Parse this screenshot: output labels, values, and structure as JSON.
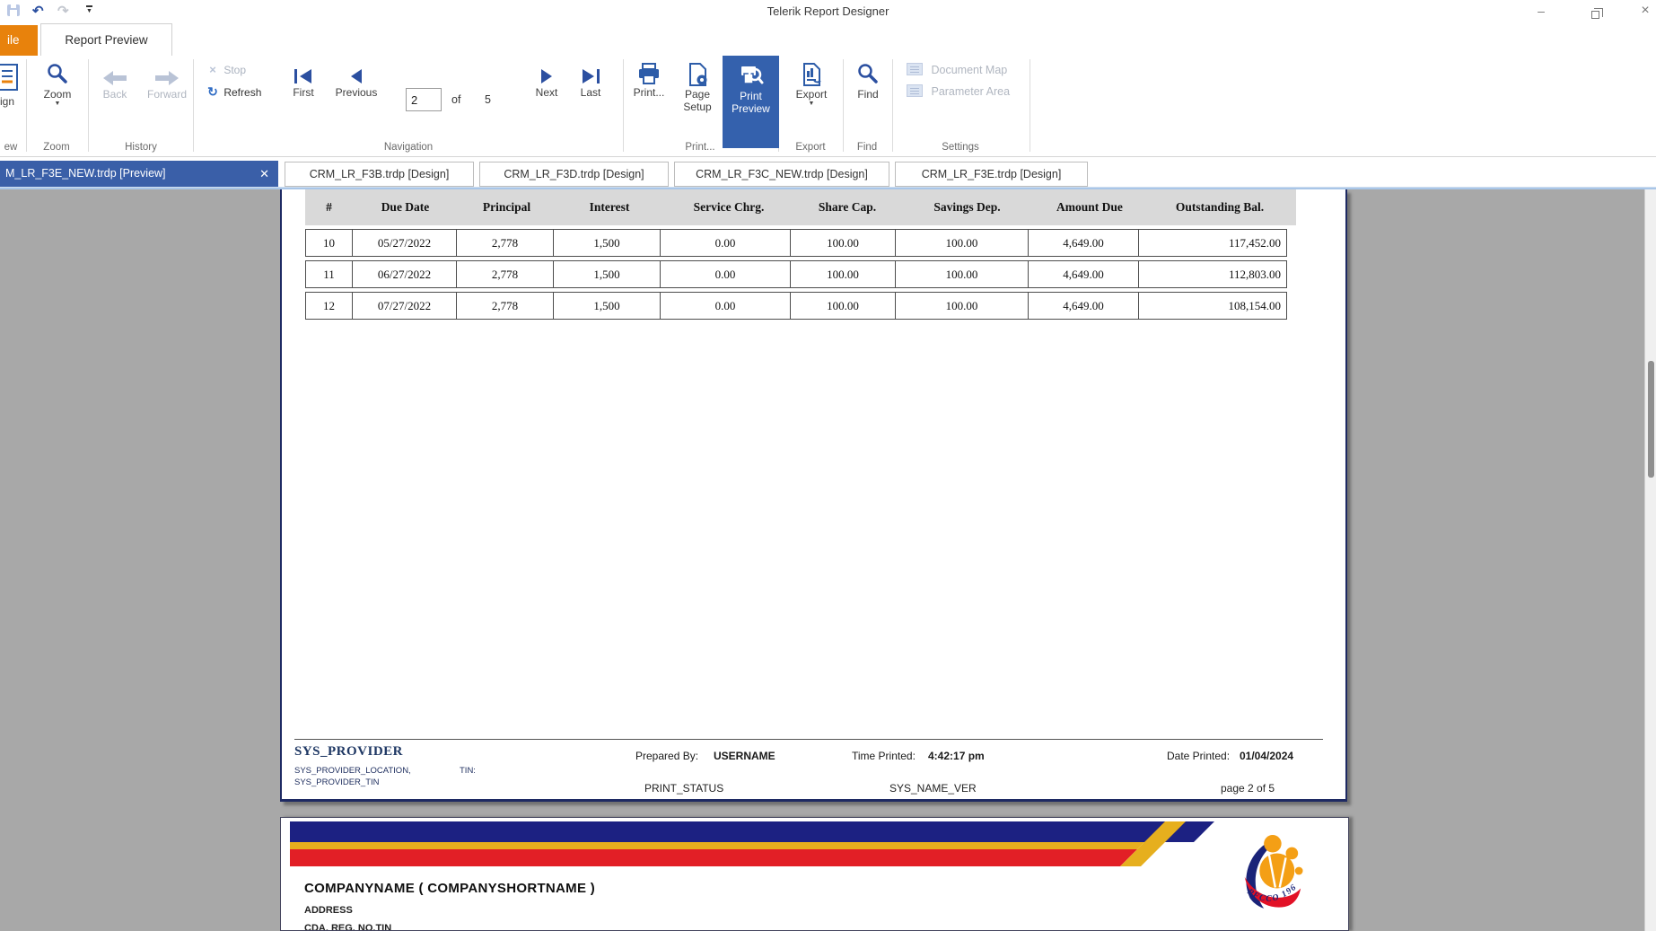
{
  "window": {
    "title": "Telerik Report Designer",
    "minimize_glyph": "–",
    "close_glyph": "×"
  },
  "quick_access": {
    "undo_glyph": "↶",
    "redo_glyph": "↷",
    "customize_glyph": "▼"
  },
  "ribbon": {
    "file_tab_partial": "ile",
    "preview_tab": "Report Preview",
    "view_group": {
      "design_partial": "ign",
      "label_partial": "ew"
    },
    "zoom_group": {
      "zoom": "Zoom",
      "dropdown": "▼",
      "label": "Zoom"
    },
    "history": {
      "back": "Back",
      "forward": "Forward",
      "label": "History"
    },
    "navigation": {
      "stop": "Stop",
      "stop_glyph": "×",
      "refresh": "Refresh",
      "refresh_glyph": "↻",
      "first": "First",
      "previous": "Previous",
      "page_value": "2",
      "of": "of",
      "total_pages": "5",
      "next": "Next",
      "last": "Last",
      "label": "Navigation"
    },
    "print_group": {
      "print": "Print...",
      "page_setup_line1": "Page",
      "page_setup_line2": "Setup",
      "print_preview_line1": "Print",
      "print_preview_line2": "Preview",
      "label": "Print..."
    },
    "export_group": {
      "export": "Export",
      "dropdown": "▼",
      "label": "Export"
    },
    "find_group": {
      "find": "Find",
      "label": "Find"
    },
    "settings": {
      "document_map": "Document Map",
      "parameter_area": "Parameter Area",
      "label": "Settings"
    }
  },
  "document_tabs": {
    "active": {
      "label": "M_LR_F3E_NEW.trdp [Preview]",
      "close_glyph": "✕"
    },
    "tabs": [
      "CRM_LR_F3B.trdp [Design]",
      "CRM_LR_F3D.trdp [Design]",
      "CRM_LR_F3C_NEW.trdp [Design]",
      "CRM_LR_F3E.trdp [Design]"
    ]
  },
  "page1": {
    "table": {
      "headers": [
        "#",
        "Due Date",
        "Principal",
        "Interest",
        "Service Chrg.",
        "Share Cap.",
        "Savings Dep.",
        "Amount Due",
        "Outstanding Bal."
      ],
      "rows": [
        [
          "10",
          "05/27/2022",
          "2,778",
          "1,500",
          "0.00",
          "100.00",
          "100.00",
          "4,649.00",
          "117,452.00"
        ],
        [
          "11",
          "06/27/2022",
          "2,778",
          "1,500",
          "0.00",
          "100.00",
          "100.00",
          "4,649.00",
          "112,803.00"
        ],
        [
          "12",
          "07/27/2022",
          "2,778",
          "1,500",
          "0.00",
          "100.00",
          "100.00",
          "4,649.00",
          "108,154.00"
        ]
      ]
    },
    "footer": {
      "provider": "SYS_PROVIDER",
      "provider_location": "SYS_PROVIDER_LOCATION,",
      "tin_label": "TIN:",
      "provider_tin": "SYS_PROVIDER_TIN",
      "prepared_by_label": "Prepared By:",
      "prepared_by_value": "USERNAME",
      "time_printed_label": "Time Printed:",
      "time_printed_value": "4:42:17 pm",
      "date_printed_label": "Date Printed:",
      "date_printed_value": "01/04/2024",
      "print_status": "PRINT_STATUS",
      "sys_name_ver": "SYS_NAME_VER",
      "page_info": "page 2 of 5"
    }
  },
  "page2": {
    "company": "COMPANYNAME ( COMPANYSHORTNAME )",
    "address": "ADDRESS",
    "reg_line": "CDA. REG. NO.TIN",
    "logo_text": "PFCCO 1960"
  },
  "colors": {
    "accent_blue": "#3461ad",
    "file_tab_orange": "#e8820c",
    "active_doc_tab_blue": "#3a5fa8",
    "stripe_navy": "#1c2182",
    "stripe_gold": "#e6af1e",
    "stripe_red": "#e21f26",
    "footer_navy": "#1f3864",
    "logo_orange": "#f49f15",
    "preview_background": "#a8a8a8"
  }
}
